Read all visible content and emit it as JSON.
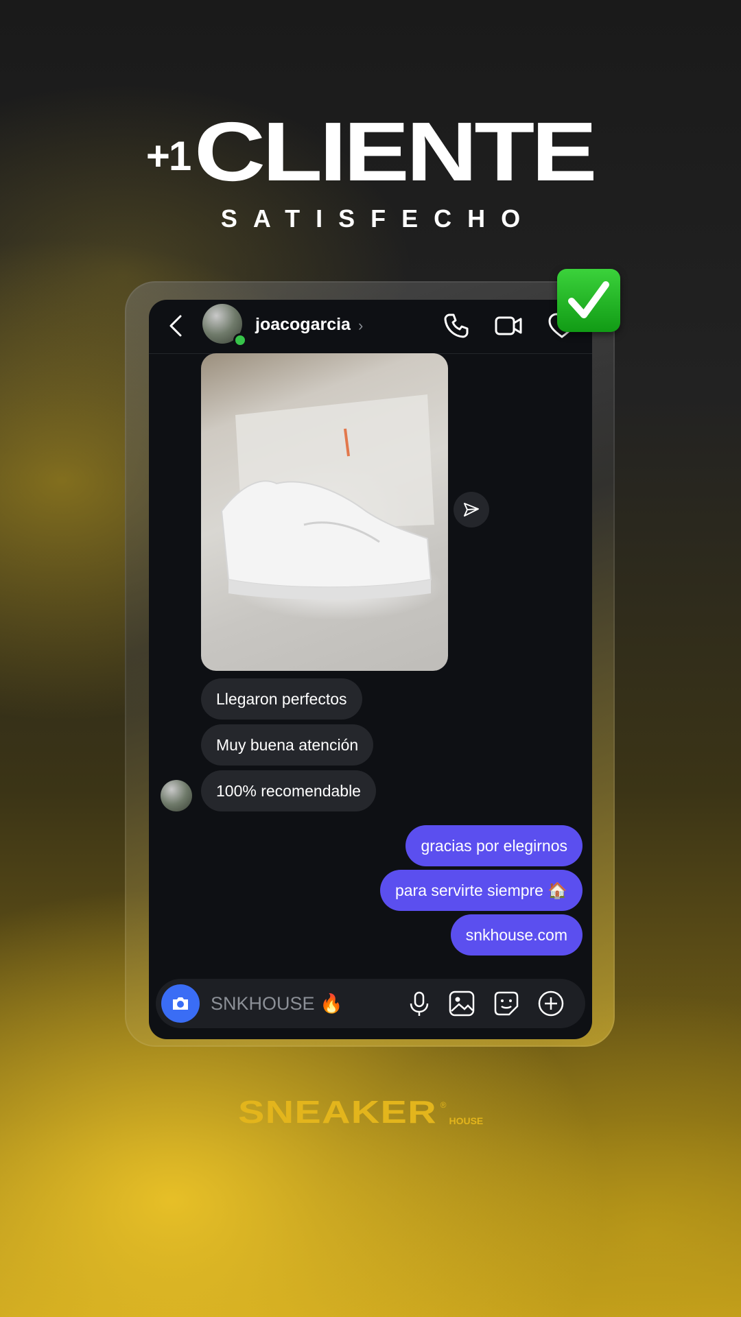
{
  "header": {
    "plus": "+1",
    "title": "CLIENTE",
    "subtitle": "SATISFECHO"
  },
  "chat": {
    "username": "joacogarcia",
    "online": true,
    "incoming": [
      "Llegaron perfectos",
      "Muy buena atención",
      "100% recomendable"
    ],
    "outgoing": [
      "gracias por elegirnos",
      "para servirte siempre 🏠",
      "snkhouse.com"
    ],
    "composer_placeholder": "SNKHOUSE 🔥"
  },
  "brand": {
    "name": "SNEAKER",
    "registered": "®",
    "suffix": "HOUSE"
  },
  "colors": {
    "outgoing_bubble": "#5b4fef",
    "incoming_bubble": "#25272c",
    "accent_yellow": "#e3b51c",
    "camera_button": "#3a6df5",
    "check_badge": "#22b726"
  },
  "icons": [
    "back-chevron-icon",
    "phone-icon",
    "video-icon",
    "heart-icon",
    "share-icon",
    "camera-icon",
    "mic-icon",
    "gallery-icon",
    "sticker-icon",
    "plus-circle-icon",
    "checkmark-icon"
  ]
}
